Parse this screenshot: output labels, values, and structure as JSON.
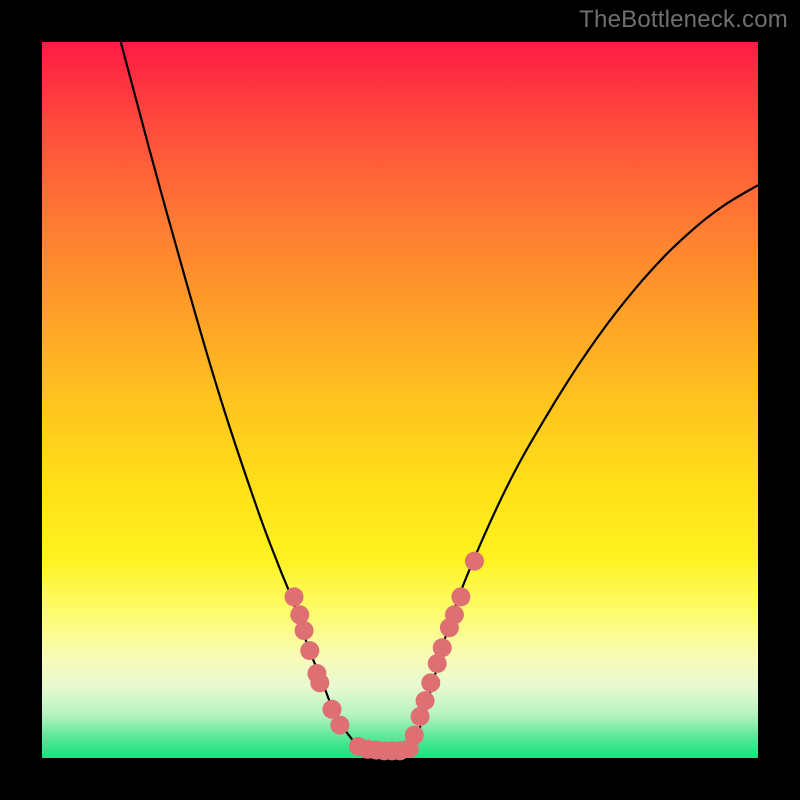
{
  "watermark": "TheBottleneck.com",
  "colors": {
    "background": "#000000",
    "curve": "#000000",
    "dot": "#de6f72",
    "gradient_top": "#ff1a45",
    "gradient_bottom": "#20df7f"
  },
  "chart_data": {
    "type": "line",
    "title": "",
    "xlabel": "",
    "ylabel": "",
    "xlim": [
      0,
      100
    ],
    "ylim": [
      0,
      100
    ],
    "curve": {
      "left": [
        {
          "x": 11,
          "y": 100
        },
        {
          "x": 15,
          "y": 85
        },
        {
          "x": 20,
          "y": 67
        },
        {
          "x": 25,
          "y": 50
        },
        {
          "x": 30,
          "y": 35
        },
        {
          "x": 33,
          "y": 27
        },
        {
          "x": 35,
          "y": 22
        },
        {
          "x": 37,
          "y": 16
        },
        {
          "x": 39,
          "y": 11
        },
        {
          "x": 41,
          "y": 6
        },
        {
          "x": 43,
          "y": 3
        },
        {
          "x": 44.5,
          "y": 1.4
        }
      ],
      "bottom": [
        {
          "x": 44.5,
          "y": 1.4
        },
        {
          "x": 46,
          "y": 1.1
        },
        {
          "x": 48,
          "y": 1.0
        },
        {
          "x": 50,
          "y": 1.0
        },
        {
          "x": 51.5,
          "y": 1.0
        }
      ],
      "right": [
        {
          "x": 51.5,
          "y": 1.0
        },
        {
          "x": 53,
          "y": 5
        },
        {
          "x": 55,
          "y": 12
        },
        {
          "x": 57,
          "y": 19
        },
        {
          "x": 60,
          "y": 27
        },
        {
          "x": 65,
          "y": 38
        },
        {
          "x": 70,
          "y": 47
        },
        {
          "x": 75,
          "y": 55
        },
        {
          "x": 80,
          "y": 62
        },
        {
          "x": 85,
          "y": 68
        },
        {
          "x": 90,
          "y": 73
        },
        {
          "x": 95,
          "y": 77
        },
        {
          "x": 100,
          "y": 80
        }
      ]
    },
    "series": [
      {
        "name": "left-branch-dots",
        "points": [
          {
            "x": 35.2,
            "y": 22.5
          },
          {
            "x": 36.0,
            "y": 20.0
          },
          {
            "x": 36.6,
            "y": 17.8
          },
          {
            "x": 37.4,
            "y": 15.0
          },
          {
            "x": 38.4,
            "y": 11.8
          },
          {
            "x": 38.8,
            "y": 10.5
          },
          {
            "x": 40.5,
            "y": 6.8
          },
          {
            "x": 41.6,
            "y": 4.6
          },
          {
            "x": 44.2,
            "y": 1.6
          },
          {
            "x": 45.5,
            "y": 1.2
          },
          {
            "x": 46.7,
            "y": 1.1
          },
          {
            "x": 47.8,
            "y": 1.0
          },
          {
            "x": 48.9,
            "y": 1.0
          },
          {
            "x": 50.0,
            "y": 1.0
          },
          {
            "x": 51.3,
            "y": 1.3
          }
        ]
      },
      {
        "name": "right-branch-dots",
        "points": [
          {
            "x": 52.0,
            "y": 3.2
          },
          {
            "x": 52.8,
            "y": 5.8
          },
          {
            "x": 53.5,
            "y": 8.0
          },
          {
            "x": 54.3,
            "y": 10.5
          },
          {
            "x": 55.2,
            "y": 13.2
          },
          {
            "x": 55.9,
            "y": 15.4
          },
          {
            "x": 56.9,
            "y": 18.2
          },
          {
            "x": 57.6,
            "y": 20.0
          },
          {
            "x": 58.5,
            "y": 22.5
          },
          {
            "x": 60.4,
            "y": 27.5
          }
        ]
      }
    ]
  }
}
